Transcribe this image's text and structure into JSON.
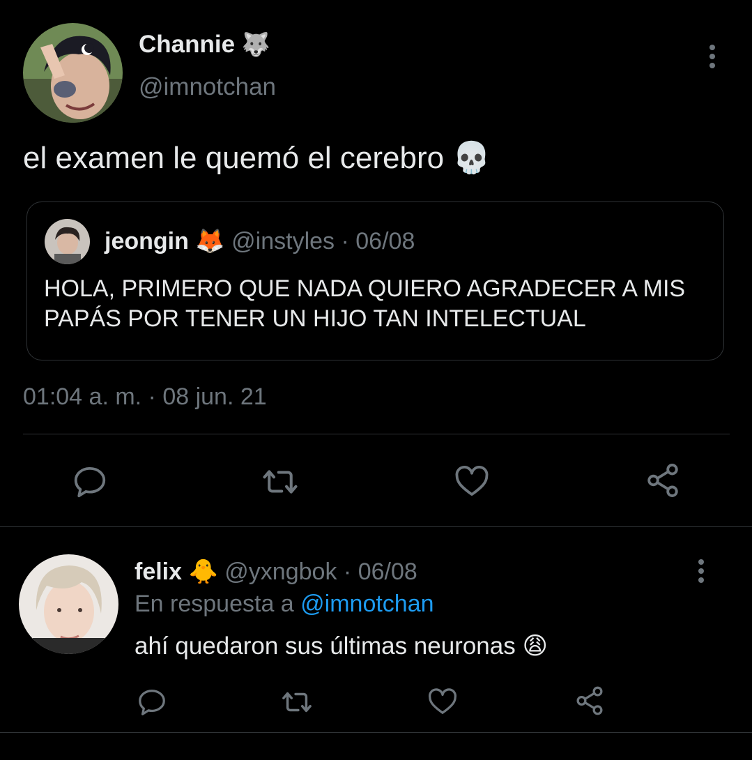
{
  "main_tweet": {
    "author": {
      "display_name": "Channie",
      "emoji": "🐺",
      "handle": "@imnotchan"
    },
    "text": "el examen le quemó el cerebro",
    "text_emoji": "💀",
    "quoted": {
      "display_name": "jeongin",
      "emoji": "🦊",
      "handle": "@instyles",
      "separator": "·",
      "date": "06/08",
      "text": "HOLA, PRIMERO QUE NADA QUIERO AGRADECER A MIS PAPÁS POR TENER UN HIJO TAN INTELECTUAL"
    },
    "timestamp": "01:04 a. m. · 08 jun. 21",
    "actions": [
      "reply-icon",
      "retweet-icon",
      "like-icon",
      "share-icon"
    ]
  },
  "reply": {
    "display_name": "felix",
    "emoji": "🐥",
    "handle": "@yxngbok",
    "separator": "·",
    "date": "06/08",
    "in_reply_prefix": "En respuesta a",
    "in_reply_handle": "@imnotchan",
    "text": "ahí quedaron sus últimas neuronas",
    "text_emoji": "😩"
  },
  "colors": {
    "background": "#000000",
    "text": "#e7e9ea",
    "muted": "#6e767d",
    "link": "#1d9bf0",
    "border": "#2f3336"
  }
}
